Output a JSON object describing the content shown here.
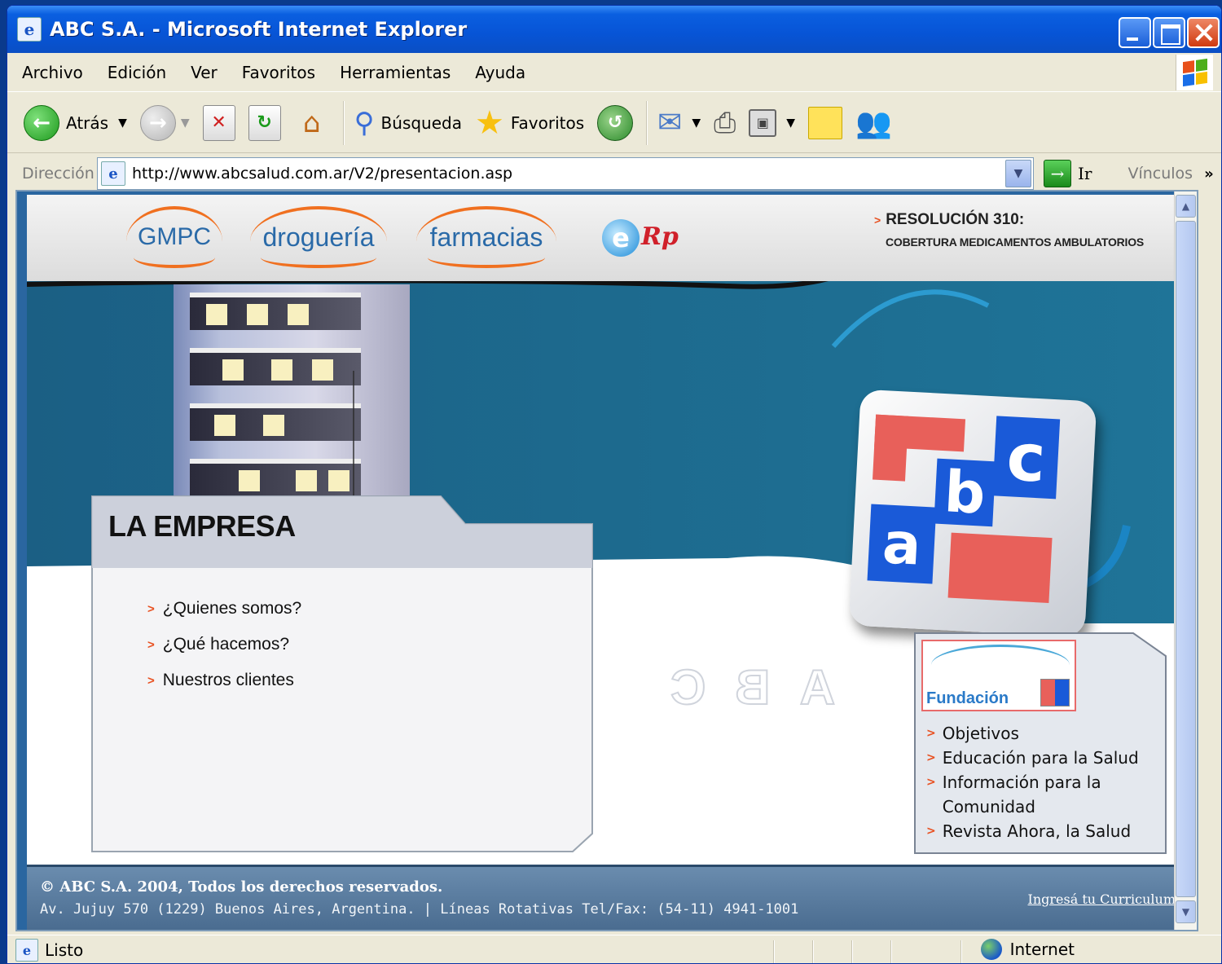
{
  "window": {
    "title": "ABC S.A. - Microsoft Internet Explorer"
  },
  "menu": [
    "Archivo",
    "Edición",
    "Ver",
    "Favoritos",
    "Herramientas",
    "Ayuda"
  ],
  "toolbar": {
    "back_label": "Atrás",
    "search_label": "Búsqueda",
    "favorites_label": "Favoritos"
  },
  "address": {
    "label": "Dirección",
    "url": "http://www.abcsalud.com.ar/V2/presentacion.asp",
    "go_label": "Ir",
    "links_label": "Vínculos"
  },
  "site": {
    "header_logos": {
      "gmpc": "GMPC",
      "drogueria": "droguería",
      "farmacias": "farmacias",
      "erp": "Rp"
    },
    "resolution": {
      "title": "RESOLUCIÓN 310:",
      "subtitle": "COBERTURA MEDICAMENTOS AMBULATORIOS"
    },
    "empresa": {
      "title": "LA EMPRESA",
      "links": [
        "¿Quienes somos?",
        "¿Qué hacemos?",
        "Nuestros clientes"
      ]
    },
    "ghost_letters": [
      "C",
      "B",
      "A"
    ],
    "fundacion": {
      "logo_text": "Fundación",
      "links": [
        "Objetivos",
        "Educación para la Salud",
        "Información para la Comunidad",
        "Revista Ahora, la Salud"
      ]
    },
    "footer": {
      "copyright": "© ABC S.A. 2004, Todos los derechos reservados.",
      "address": "Av. Jujuy 570 (1229) Buenos Aires, Argentina. | Líneas Rotativas Tel/Fax: (54-11) 4941-1001",
      "cv_link": "Ingresá tu Curriculum"
    }
  },
  "status": {
    "text": "Listo",
    "zone": "Internet"
  },
  "colors": {
    "accent_orange": "#f07020",
    "brand_blue": "#1a5ad8",
    "brand_red": "#e8605a",
    "banner_teal": "#1d6a8e"
  }
}
